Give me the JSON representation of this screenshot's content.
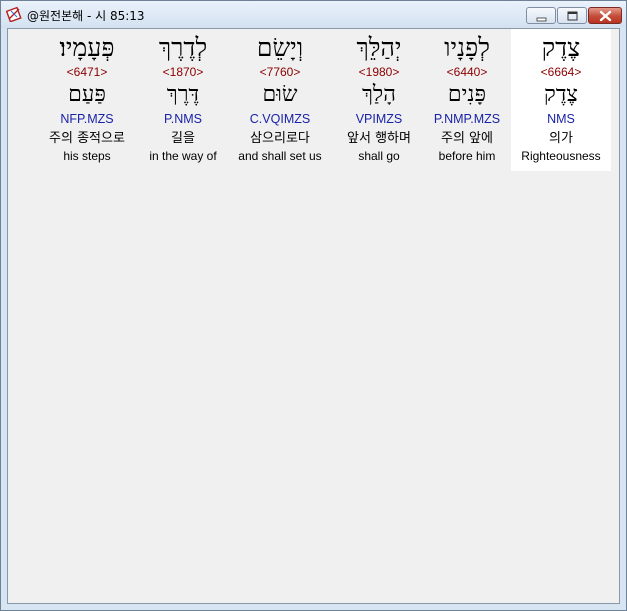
{
  "window": {
    "title": "@원전본해 - 시 85:13",
    "icon": "app-logo-icon",
    "controls": [
      "minimize-icon",
      "maximize-icon",
      "close-icon"
    ],
    "accent_colors": {
      "strong_number": "#8b0000",
      "morphology": "#1a22a8",
      "selected_background": "#ffffff",
      "panel_background": "#f0f0f0"
    }
  },
  "words": [
    {
      "hebrew": "פְּעָמָיו׃",
      "strong": "<6471>",
      "lexeme": "פַּעַם",
      "morph": "NFP.MZS",
      "korean": "주의 종적으로",
      "english": "his steps",
      "selected": false
    },
    {
      "hebrew": "לְדֶרֶךְ",
      "strong": "<1870>",
      "lexeme": "דֶּרֶךְ",
      "morph": "P.NMS",
      "korean": "길을",
      "english": "in the way of",
      "selected": false
    },
    {
      "hebrew": "וְיָשֵׂם",
      "strong": "<7760>",
      "lexeme": "שׂוּם",
      "morph": "C.VQIMZS",
      "korean": "삼으리로다",
      "english": "and shall set us",
      "selected": false
    },
    {
      "hebrew": "יְהַלֵּךְ",
      "strong": "<1980>",
      "lexeme": "הָלַךְ",
      "morph": "VPIMZS",
      "korean": "앞서 행하며",
      "english": "shall go",
      "selected": false
    },
    {
      "hebrew": "לְפָנָיו",
      "strong": "<6440>",
      "lexeme": "פָּנִים",
      "morph": "P.NMP.MZS",
      "korean": "주의 앞에",
      "english": "before him",
      "selected": false
    },
    {
      "hebrew": "צֶדֶק",
      "strong": "<6664>",
      "lexeme": "צֶדֶק",
      "morph": "NMS",
      "korean": "의가",
      "english": "Righteousness",
      "selected": true
    }
  ]
}
